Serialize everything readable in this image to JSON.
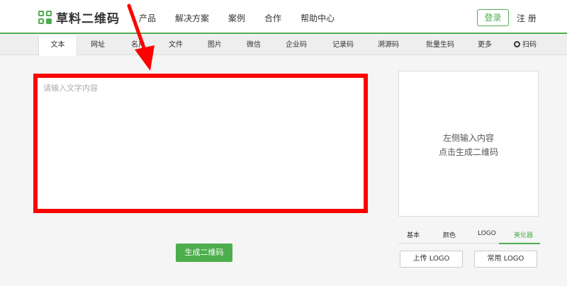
{
  "brand": {
    "name": "草料二维码"
  },
  "nav": [
    "产品",
    "解决方案",
    "案例",
    "合作",
    "帮助中心"
  ],
  "auth": {
    "login_label": "登录",
    "register_label": "注 册"
  },
  "tabs": [
    "文本",
    "网址",
    "名片",
    "文件",
    "图片",
    "微信",
    "企业码",
    "记录码",
    "溯源码",
    "批量生码",
    "更多",
    "扫码"
  ],
  "active_tab": "文本",
  "editor": {
    "placeholder": "请输入文字内容",
    "value": ""
  },
  "generate_label": "生成二维码",
  "preview": {
    "line1": "左侧输入内容",
    "line2": "点击生成二维码"
  },
  "style_tabs": [
    "基本",
    "颜色",
    "LOGO",
    "美化器"
  ],
  "logo_buttons": {
    "upload": "上传 LOGO",
    "common": "常用 LOGO"
  },
  "colors": {
    "accent": "#4cae4c",
    "highlight": "#ff0000"
  }
}
